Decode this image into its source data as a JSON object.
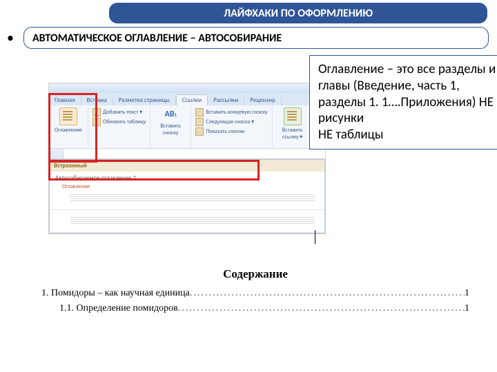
{
  "title": "ЛАЙФХАКИ ПО ОФОРМЛЕНИЮ",
  "subtitle": "АВТОМАТИЧЕСКОЕ ОГЛАВЛЕНИЕ – АВТОСОБИРАНИЕ",
  "explain": "Оглавление – это все разделы и главы (Введение, часть 1, разделы 1. 1….Приложения) НЕ рисунки\nНЕ таблицы",
  "word": {
    "tabs": [
      "Главная",
      "Вставка",
      "Разметка страницы",
      "Ссылки",
      "Рассылки",
      "Рецензир"
    ],
    "active_tab": 3,
    "grp1": {
      "btn": "Оглавление",
      "l1": "Добавить текст ▾",
      "l2": "Обновить таблицу"
    },
    "grp2": {
      "ab": "AB",
      "sup": "1",
      "btn": "Вставить сноску",
      "l1": "Вставить концевую сноску",
      "l2": "Следующая сноска ▾",
      "l3": "Показать сноски"
    },
    "grp3": {
      "btn": "Вставить ссылку ▾"
    },
    "dropdown": {
      "head": "Встроенный",
      "item1": "Автособираемое оглавление 1",
      "sub": "Оглавление"
    }
  },
  "doc": {
    "heading": "Содержание",
    "l1_text": "1. Помидоры – как научная единица",
    "l1_page": "1",
    "l2_text": "1.1. Определение помидоров",
    "l2_page": "1"
  }
}
